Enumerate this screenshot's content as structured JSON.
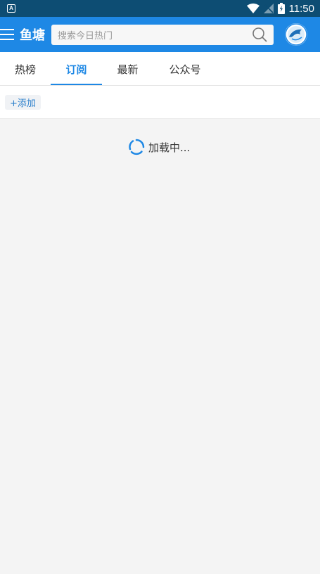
{
  "status_bar": {
    "notification_icon_letter": "A",
    "time": "11:50"
  },
  "header": {
    "brand": "鱼塘",
    "search": {
      "placeholder": "搜索今日热门"
    }
  },
  "tabs": [
    {
      "label": "热榜",
      "active": false
    },
    {
      "label": "订阅",
      "active": true
    },
    {
      "label": "最新",
      "active": false
    },
    {
      "label": "公众号",
      "active": false
    }
  ],
  "subscribe": {
    "add_label": "+添加"
  },
  "content": {
    "loading_text": "加载中..."
  },
  "colors": {
    "primary": "#1e88e5",
    "status_bar": "#0d4d73",
    "background": "#f4f4f4"
  }
}
